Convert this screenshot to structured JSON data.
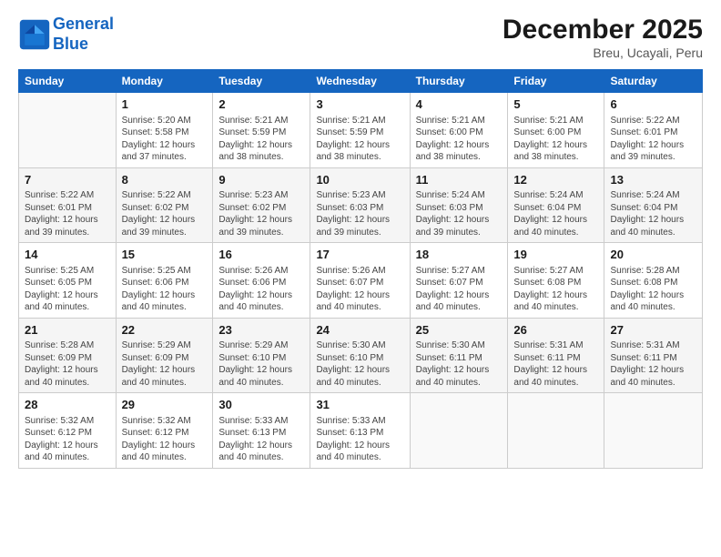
{
  "header": {
    "logo_line1": "General",
    "logo_line2": "Blue",
    "month": "December 2025",
    "location": "Breu, Ucayali, Peru"
  },
  "weekdays": [
    "Sunday",
    "Monday",
    "Tuesday",
    "Wednesday",
    "Thursday",
    "Friday",
    "Saturday"
  ],
  "weeks": [
    [
      {
        "day": "",
        "info": ""
      },
      {
        "day": "1",
        "info": "Sunrise: 5:20 AM\nSunset: 5:58 PM\nDaylight: 12 hours\nand 37 minutes."
      },
      {
        "day": "2",
        "info": "Sunrise: 5:21 AM\nSunset: 5:59 PM\nDaylight: 12 hours\nand 38 minutes."
      },
      {
        "day": "3",
        "info": "Sunrise: 5:21 AM\nSunset: 5:59 PM\nDaylight: 12 hours\nand 38 minutes."
      },
      {
        "day": "4",
        "info": "Sunrise: 5:21 AM\nSunset: 6:00 PM\nDaylight: 12 hours\nand 38 minutes."
      },
      {
        "day": "5",
        "info": "Sunrise: 5:21 AM\nSunset: 6:00 PM\nDaylight: 12 hours\nand 38 minutes."
      },
      {
        "day": "6",
        "info": "Sunrise: 5:22 AM\nSunset: 6:01 PM\nDaylight: 12 hours\nand 39 minutes."
      }
    ],
    [
      {
        "day": "7",
        "info": "Sunrise: 5:22 AM\nSunset: 6:01 PM\nDaylight: 12 hours\nand 39 minutes."
      },
      {
        "day": "8",
        "info": "Sunrise: 5:22 AM\nSunset: 6:02 PM\nDaylight: 12 hours\nand 39 minutes."
      },
      {
        "day": "9",
        "info": "Sunrise: 5:23 AM\nSunset: 6:02 PM\nDaylight: 12 hours\nand 39 minutes."
      },
      {
        "day": "10",
        "info": "Sunrise: 5:23 AM\nSunset: 6:03 PM\nDaylight: 12 hours\nand 39 minutes."
      },
      {
        "day": "11",
        "info": "Sunrise: 5:24 AM\nSunset: 6:03 PM\nDaylight: 12 hours\nand 39 minutes."
      },
      {
        "day": "12",
        "info": "Sunrise: 5:24 AM\nSunset: 6:04 PM\nDaylight: 12 hours\nand 40 minutes."
      },
      {
        "day": "13",
        "info": "Sunrise: 5:24 AM\nSunset: 6:04 PM\nDaylight: 12 hours\nand 40 minutes."
      }
    ],
    [
      {
        "day": "14",
        "info": "Sunrise: 5:25 AM\nSunset: 6:05 PM\nDaylight: 12 hours\nand 40 minutes."
      },
      {
        "day": "15",
        "info": "Sunrise: 5:25 AM\nSunset: 6:06 PM\nDaylight: 12 hours\nand 40 minutes."
      },
      {
        "day": "16",
        "info": "Sunrise: 5:26 AM\nSunset: 6:06 PM\nDaylight: 12 hours\nand 40 minutes."
      },
      {
        "day": "17",
        "info": "Sunrise: 5:26 AM\nSunset: 6:07 PM\nDaylight: 12 hours\nand 40 minutes."
      },
      {
        "day": "18",
        "info": "Sunrise: 5:27 AM\nSunset: 6:07 PM\nDaylight: 12 hours\nand 40 minutes."
      },
      {
        "day": "19",
        "info": "Sunrise: 5:27 AM\nSunset: 6:08 PM\nDaylight: 12 hours\nand 40 minutes."
      },
      {
        "day": "20",
        "info": "Sunrise: 5:28 AM\nSunset: 6:08 PM\nDaylight: 12 hours\nand 40 minutes."
      }
    ],
    [
      {
        "day": "21",
        "info": "Sunrise: 5:28 AM\nSunset: 6:09 PM\nDaylight: 12 hours\nand 40 minutes."
      },
      {
        "day": "22",
        "info": "Sunrise: 5:29 AM\nSunset: 6:09 PM\nDaylight: 12 hours\nand 40 minutes."
      },
      {
        "day": "23",
        "info": "Sunrise: 5:29 AM\nSunset: 6:10 PM\nDaylight: 12 hours\nand 40 minutes."
      },
      {
        "day": "24",
        "info": "Sunrise: 5:30 AM\nSunset: 6:10 PM\nDaylight: 12 hours\nand 40 minutes."
      },
      {
        "day": "25",
        "info": "Sunrise: 5:30 AM\nSunset: 6:11 PM\nDaylight: 12 hours\nand 40 minutes."
      },
      {
        "day": "26",
        "info": "Sunrise: 5:31 AM\nSunset: 6:11 PM\nDaylight: 12 hours\nand 40 minutes."
      },
      {
        "day": "27",
        "info": "Sunrise: 5:31 AM\nSunset: 6:11 PM\nDaylight: 12 hours\nand 40 minutes."
      }
    ],
    [
      {
        "day": "28",
        "info": "Sunrise: 5:32 AM\nSunset: 6:12 PM\nDaylight: 12 hours\nand 40 minutes."
      },
      {
        "day": "29",
        "info": "Sunrise: 5:32 AM\nSunset: 6:12 PM\nDaylight: 12 hours\nand 40 minutes."
      },
      {
        "day": "30",
        "info": "Sunrise: 5:33 AM\nSunset: 6:13 PM\nDaylight: 12 hours\nand 40 minutes."
      },
      {
        "day": "31",
        "info": "Sunrise: 5:33 AM\nSunset: 6:13 PM\nDaylight: 12 hours\nand 40 minutes."
      },
      {
        "day": "",
        "info": ""
      },
      {
        "day": "",
        "info": ""
      },
      {
        "day": "",
        "info": ""
      }
    ]
  ]
}
